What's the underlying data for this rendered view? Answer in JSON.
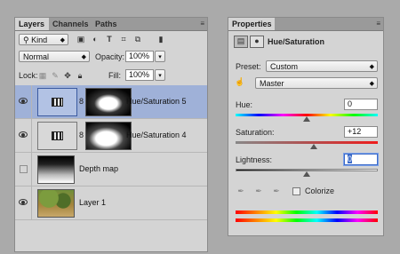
{
  "layers_panel": {
    "tabs": [
      "Layers",
      "Channels",
      "Paths"
    ],
    "filter": {
      "label": "Kind"
    },
    "blend_mode": "Normal",
    "opacity": {
      "label": "Opacity:",
      "value": "100%"
    },
    "lock": {
      "label": "Lock:"
    },
    "fill": {
      "label": "Fill:",
      "value": "100%"
    },
    "layers": [
      {
        "name": "Hue/Saturation 5",
        "type": "adjustment",
        "visible": true,
        "selected": true
      },
      {
        "name": "Hue/Saturation 4",
        "type": "adjustment",
        "visible": true,
        "selected": false
      },
      {
        "name": "Depth map",
        "type": "image",
        "visible": false,
        "selected": false
      },
      {
        "name": "Layer 1",
        "type": "image",
        "visible": true,
        "selected": false
      }
    ]
  },
  "properties_panel": {
    "tab": "Properties",
    "title": "Hue/Saturation",
    "preset": {
      "label": "Preset:",
      "value": "Custom"
    },
    "range": {
      "value": "Master"
    },
    "hue": {
      "label": "Hue:",
      "value": "0"
    },
    "saturation": {
      "label": "Saturation:",
      "value": "+12"
    },
    "lightness": {
      "label": "Lightness:",
      "value": "0"
    },
    "colorize": {
      "label": "Colorize",
      "checked": false
    }
  },
  "colors": {
    "selection": "#9fb1d8",
    "panel": "#d4d4d4",
    "background": "#aaaaaa"
  }
}
